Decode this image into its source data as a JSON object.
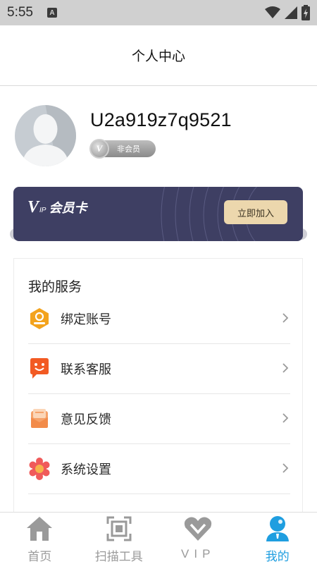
{
  "status_bar": {
    "time": "5:55",
    "notification_glyph": "A"
  },
  "header": {
    "title": "个人中心"
  },
  "profile": {
    "username": "U2a919z7q9521",
    "member_status": "非会员",
    "badge_letter": "V"
  },
  "vip_card": {
    "logo_v": "V",
    "logo_ip": "IP",
    "logo_text": "会员卡",
    "join_label": "立即加入"
  },
  "services": {
    "title": "我的服务",
    "items": [
      {
        "label": "绑定账号",
        "icon": "bind-account-icon"
      },
      {
        "label": "联系客服",
        "icon": "customer-service-icon"
      },
      {
        "label": "意见反馈",
        "icon": "feedback-icon"
      },
      {
        "label": "系统设置",
        "icon": "settings-icon"
      }
    ]
  },
  "bottom_nav": {
    "items": [
      {
        "label": "首页",
        "icon": "home-icon",
        "active": false
      },
      {
        "label": "扫描工具",
        "icon": "scan-icon",
        "active": false
      },
      {
        "label": "VIP",
        "icon": "vip-heart-icon",
        "active": false
      },
      {
        "label": "我的",
        "icon": "profile-icon",
        "active": true
      }
    ]
  },
  "colors": {
    "accent": "#1f9ee0",
    "vip_card_bg": "#3e3f63",
    "join_button_bg": "#ecd7ad",
    "status_bar_bg": "#d0d0d0",
    "nav_inactive": "#9a9a9a"
  }
}
